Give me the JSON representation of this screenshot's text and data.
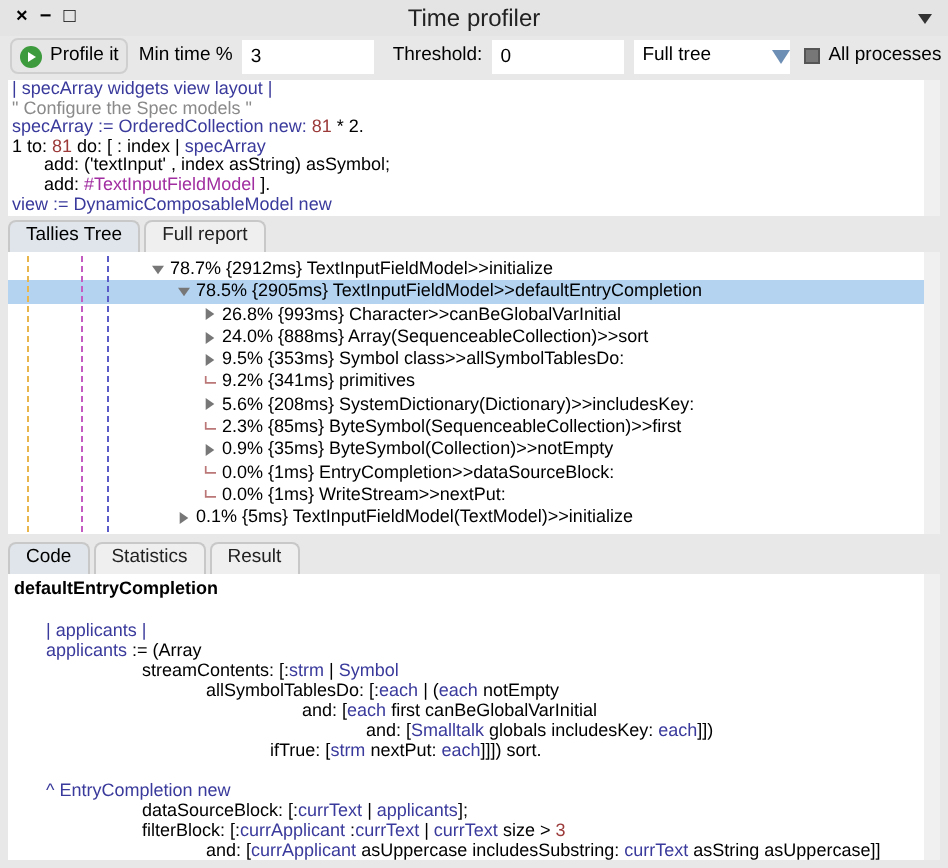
{
  "window": {
    "controls": [
      "×",
      "−",
      "□"
    ],
    "title": "Time profiler"
  },
  "toolbar": {
    "profile_button": "Profile it",
    "min_time": {
      "label": "Min time %",
      "value": "3"
    },
    "threshold": {
      "label": "Threshold:",
      "value": "0"
    },
    "mode": {
      "value": "Full tree"
    },
    "all_processes": {
      "label": "All processes",
      "checked": false
    }
  },
  "script_editor": {
    "lines": [
      {
        "kind": "code",
        "segments": [
          {
            "text": "| specArray widgets view layout |",
            "kind": "var"
          }
        ]
      },
      {
        "kind": "code",
        "segments": [
          {
            "text": "\" Configure the Spec models \"",
            "kind": "comment"
          }
        ]
      },
      {
        "kind": "code",
        "segments": [
          {
            "text": "specArray := OrderedCollection new: ",
            "kind": "var"
          },
          {
            "text": "81",
            "kind": "number"
          },
          {
            "text": " * 2.",
            "kind": "plain"
          }
        ]
      },
      {
        "kind": "code",
        "segments": [
          {
            "text": "1 to: ",
            "kind": "plain"
          },
          {
            "text": "81",
            "kind": "number"
          },
          {
            "text": " do: [ : index | ",
            "kind": "plain"
          },
          {
            "text": "specArray",
            "kind": "var"
          }
        ]
      },
      {
        "kind": "code",
        "segments": [
          {
            "text": "\tadd: ('textInput' , index asString) asSymbol;",
            "kind": "plain"
          }
        ]
      },
      {
        "kind": "code",
        "segments": [
          {
            "text": "\tadd: ",
            "kind": "plain"
          },
          {
            "text": "#TextInputFieldModel",
            "kind": "symbol"
          },
          {
            "text": " ].",
            "kind": "plain"
          }
        ]
      },
      {
        "kind": "code",
        "segments": [
          {
            "text": "view := DynamicComposableModel new",
            "kind": "var"
          }
        ]
      }
    ]
  },
  "result_tabs": [
    {
      "label": "Tallies Tree",
      "selected": true
    },
    {
      "label": "Full report",
      "selected": false
    }
  ],
  "tree": [
    {
      "kind": "node",
      "expanded": true,
      "selected": false,
      "label": "78.7% {2912ms} TextInputFieldModel>>initialize",
      "children": [
        {
          "kind": "node",
          "expanded": true,
          "selected": true,
          "label": "78.5% {2905ms} TextInputFieldModel>>defaultEntryCompletion",
          "children": [
            {
              "kind": "node",
              "expanded": false,
              "selected": false,
              "label": "26.8% {993ms} Character>>canBeGlobalVarInitial"
            },
            {
              "kind": "node",
              "expanded": false,
              "selected": false,
              "label": "24.0% {888ms} Array(SequenceableCollection)>>sort"
            },
            {
              "kind": "node",
              "expanded": false,
              "selected": false,
              "label": "9.5% {353ms} Symbol class>>allSymbolTablesDo:"
            },
            {
              "kind": "leaf",
              "selected": false,
              "label": "9.2% {341ms} primitives"
            },
            {
              "kind": "node",
              "expanded": false,
              "selected": false,
              "label": "5.6% {208ms} SystemDictionary(Dictionary)>>includesKey:"
            },
            {
              "kind": "leaf",
              "selected": false,
              "label": "2.3% {85ms} ByteSymbol(SequenceableCollection)>>first"
            },
            {
              "kind": "node",
              "expanded": false,
              "selected": false,
              "label": "0.9% {35ms} ByteSymbol(Collection)>>notEmpty"
            },
            {
              "kind": "leaf",
              "selected": false,
              "label": "0.0% {1ms} EntryCompletion>>dataSourceBlock:"
            },
            {
              "kind": "leaf",
              "selected": false,
              "label": "0.0% {1ms} WriteStream>>nextPut:"
            }
          ]
        },
        {
          "kind": "node",
          "expanded": false,
          "selected": false,
          "label": "0.1% {5ms} TextInputFieldModel(TextModel)>>initialize"
        }
      ]
    }
  ],
  "detail_tabs": [
    {
      "label": "Code",
      "selected": true
    },
    {
      "label": "Statistics",
      "selected": false
    },
    {
      "label": "Result",
      "selected": false
    }
  ],
  "method_source": {
    "title": "defaultEntryCompletion",
    "lines": [
      {
        "kind": "blank"
      },
      {
        "kind": "code",
        "segments": [
          {
            "text": "\t| applicants |",
            "kind": "var"
          }
        ]
      },
      {
        "kind": "code",
        "segments": [
          {
            "text": "\tapplicants",
            "kind": "var"
          },
          {
            "text": " := (Array",
            "kind": "plain"
          }
        ]
      },
      {
        "kind": "code",
        "segments": [
          {
            "text": "\t\t\t\tstreamContents: [:",
            "kind": "plain"
          },
          {
            "text": "strm",
            "kind": "var"
          },
          {
            "text": " | ",
            "kind": "plain"
          },
          {
            "text": "Symbol",
            "kind": "var"
          }
        ]
      },
      {
        "kind": "code",
        "segments": [
          {
            "text": "\t\t\t\t\t\tallSymbolTablesDo: [:",
            "kind": "plain"
          },
          {
            "text": "each",
            "kind": "var"
          },
          {
            "text": " | (",
            "kind": "plain"
          },
          {
            "text": "each",
            "kind": "var"
          },
          {
            "text": " notEmpty",
            "kind": "plain"
          }
        ]
      },
      {
        "kind": "code",
        "segments": [
          {
            "text": "\t\t\t\t\t\t\t\t\tand: [",
            "kind": "plain"
          },
          {
            "text": "each",
            "kind": "var"
          },
          {
            "text": " first canBeGlobalVarInitial",
            "kind": "plain"
          }
        ]
      },
      {
        "kind": "code",
        "segments": [
          {
            "text": "\t\t\t\t\t\t\t\t\t\t\tand: [",
            "kind": "plain"
          },
          {
            "text": "Smalltalk",
            "kind": "var"
          },
          {
            "text": " globals includesKey: ",
            "kind": "plain"
          },
          {
            "text": "each",
            "kind": "var"
          },
          {
            "text": "]])",
            "kind": "plain"
          }
        ]
      },
      {
        "kind": "code",
        "segments": [
          {
            "text": "\t\t\t\t\t\t\t\tifTrue: [",
            "kind": "plain"
          },
          {
            "text": "strm",
            "kind": "var"
          },
          {
            "text": " nextPut: ",
            "kind": "plain"
          },
          {
            "text": "each",
            "kind": "var"
          },
          {
            "text": "]]]) sort.",
            "kind": "plain"
          }
        ]
      },
      {
        "kind": "blank"
      },
      {
        "kind": "code",
        "segments": [
          {
            "text": "\t^ EntryCompletion new",
            "kind": "var"
          }
        ]
      },
      {
        "kind": "code",
        "segments": [
          {
            "text": "\t\t\t\tdataSourceBlock: [:",
            "kind": "plain"
          },
          {
            "text": "currText",
            "kind": "var"
          },
          {
            "text": " | ",
            "kind": "plain"
          },
          {
            "text": "applicants",
            "kind": "var"
          },
          {
            "text": "];",
            "kind": "plain"
          }
        ]
      },
      {
        "kind": "code",
        "segments": [
          {
            "text": "\t\t\t\tfilterBlock: [:",
            "kind": "plain"
          },
          {
            "text": "currApplicant",
            "kind": "var"
          },
          {
            "text": " :",
            "kind": "plain"
          },
          {
            "text": "currText",
            "kind": "var"
          },
          {
            "text": " | ",
            "kind": "plain"
          },
          {
            "text": "currText",
            "kind": "var"
          },
          {
            "text": " size > ",
            "kind": "plain"
          },
          {
            "text": "3",
            "kind": "number"
          }
        ]
      },
      {
        "kind": "code",
        "segments": [
          {
            "text": "\t\t\t\t\t\tand: [",
            "kind": "plain"
          },
          {
            "text": "currApplicant",
            "kind": "var"
          },
          {
            "text": " asUppercase includesSubstring: ",
            "kind": "plain"
          },
          {
            "text": "currText",
            "kind": "var"
          },
          {
            "text": " asString asUppercase]]",
            "kind": "plain"
          }
        ]
      }
    ]
  }
}
